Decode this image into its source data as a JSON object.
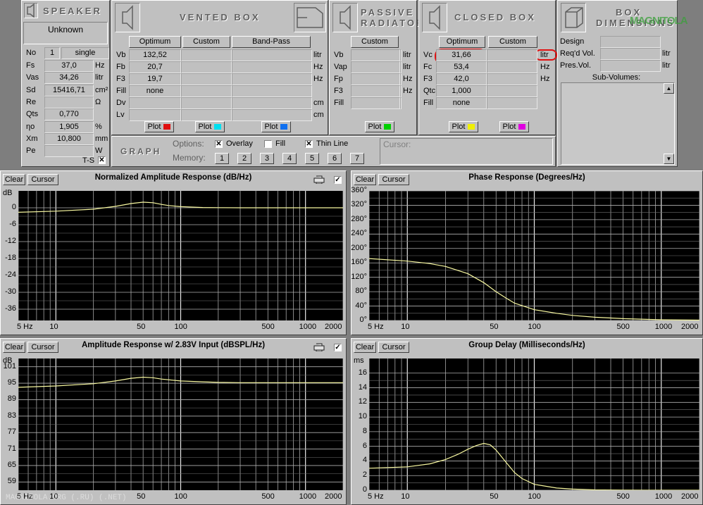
{
  "speaker": {
    "title": "SPEAKER",
    "name": "Unknown",
    "no_label": "No",
    "no_value": "1",
    "no_mode": "single",
    "params": [
      {
        "label": "Fs",
        "value": "37,0",
        "unit": "Hz"
      },
      {
        "label": "Vas",
        "value": "34,26",
        "unit": "litr"
      },
      {
        "label": "Sd",
        "value": "15416,71",
        "unit": "cm²"
      },
      {
        "label": "Re",
        "value": "",
        "unit": "Ω"
      },
      {
        "label": "Qts",
        "value": "0,770",
        "unit": ""
      },
      {
        "label": "ηo",
        "value": "1,905",
        "unit": "%"
      },
      {
        "label": "Xm",
        "value": "10,800",
        "unit": "mm"
      },
      {
        "label": "Pe",
        "value": "",
        "unit": "W"
      }
    ],
    "ts_label": "T-S"
  },
  "vented": {
    "title": "VENTED BOX",
    "tabs": [
      "Optimum",
      "Custom",
      "Band-Pass"
    ],
    "rows": [
      {
        "label": "Vb",
        "value": "132,52",
        "unit": "litr"
      },
      {
        "label": "Fb",
        "value": "20,7",
        "unit": "Hz"
      },
      {
        "label": "F3",
        "value": "19,7",
        "unit": "Hz"
      },
      {
        "label": "Fill",
        "value": "none",
        "unit": ""
      },
      {
        "label": "Dv",
        "value": "",
        "unit": "cm"
      },
      {
        "label": "Lv",
        "value": "",
        "unit": "cm"
      }
    ],
    "plot_label": "Plot"
  },
  "passive": {
    "title1": "PASSIVE",
    "title2": "RADIATOR",
    "tabs": [
      "Custom"
    ],
    "rows": [
      {
        "label": "Vb",
        "value": "",
        "unit": "litr"
      },
      {
        "label": "Vap",
        "value": "",
        "unit": "litr"
      },
      {
        "label": "Fp",
        "value": "",
        "unit": "Hz"
      },
      {
        "label": "F3",
        "value": "",
        "unit": "Hz"
      },
      {
        "label": "Fill",
        "value": "",
        "unit": ""
      }
    ],
    "plot_label": "Plot"
  },
  "closed": {
    "title": "CLOSED BOX",
    "tabs": [
      "Optimum",
      "Custom"
    ],
    "rows": [
      {
        "label": "Vc",
        "value": "31,66",
        "unit": "litr"
      },
      {
        "label": "Fc",
        "value": "53,4",
        "unit": "Hz"
      },
      {
        "label": "F3",
        "value": "42,0",
        "unit": "Hz"
      },
      {
        "label": "Qtc",
        "value": "1,000",
        "unit": ""
      },
      {
        "label": "Fill",
        "value": "none",
        "unit": ""
      }
    ],
    "plot_label": "Plot"
  },
  "dims": {
    "title1": "BOX",
    "title2": "DIMENSIONS",
    "watermark": "MAGNITOLA",
    "rows": [
      {
        "label": "Design",
        "value": "",
        "unit": ""
      },
      {
        "label": "Req'd Vol.",
        "value": "",
        "unit": "litr"
      },
      {
        "label": "Pres.Vol.",
        "value": "",
        "unit": "litr"
      }
    ],
    "subvol_label": "Sub-Volumes:"
  },
  "graph": {
    "title": "GRAPH",
    "options_label": "Options:",
    "overlay_label": "Overlay",
    "fill_label": "Fill",
    "thin_label": "Thin Line",
    "memory_label": "Memory:",
    "memory": [
      "1",
      "2",
      "3",
      "4",
      "5",
      "6",
      "7"
    ],
    "cursor_label": "Cursor:"
  },
  "buttons": {
    "clear": "Clear",
    "cursor": "Cursor"
  },
  "colors": {
    "vented_plot": "#e01010",
    "passive_plot": "#00d000",
    "closed_opt_plot": "#f0f000",
    "closed_custom_plot": "#e000e0",
    "vented_custom_plot": "#00e0f0",
    "bandpass_plot": "#1070f0",
    "curve": "#f8f8a0",
    "highlight": "#e01010"
  },
  "footer_watermark": "MAGNITOLA.ORG (.RU) (.NET)",
  "chart_data": [
    {
      "type": "line",
      "title": "Normalized Amplitude Response (dB/Hz)",
      "ylabel": "dB",
      "yticks": [
        "0",
        "-6",
        "-12",
        "-18",
        "-24",
        "-30",
        "-36"
      ],
      "ylim": [
        -40,
        6
      ],
      "xticks": [
        "5 Hz",
        "10",
        "50",
        "100",
        "500",
        "1000",
        "2000"
      ],
      "xlim": [
        5,
        2000
      ],
      "xscale": "log",
      "series": [
        {
          "x": [
            5,
            10,
            20,
            30,
            40,
            50,
            60,
            70,
            80,
            100,
            150,
            200,
            300,
            500,
            1000,
            2000
          ],
          "y": [
            -1.6,
            -1.2,
            -0.5,
            0.5,
            1.5,
            2.0,
            1.8,
            1.2,
            0.8,
            0.4,
            0.1,
            0.05,
            0.0,
            0.0,
            0.0,
            0.0
          ]
        }
      ]
    },
    {
      "type": "line",
      "title": "Phase Response (Degrees/Hz)",
      "ylabel": "",
      "yticks": [
        "360°",
        "320°",
        "280°",
        "240°",
        "200°",
        "160°",
        "120°",
        "80°",
        "40°",
        "0°"
      ],
      "ylim": [
        0,
        360
      ],
      "xticks": [
        "5 Hz",
        "10",
        "50",
        "100",
        "500",
        "1000",
        "2000"
      ],
      "xlim": [
        5,
        2000
      ],
      "xscale": "log",
      "series": [
        {
          "x": [
            5,
            10,
            15,
            20,
            30,
            40,
            50,
            60,
            70,
            100,
            150,
            200,
            300,
            500,
            1000,
            2000
          ],
          "y": [
            172,
            165,
            158,
            150,
            130,
            105,
            80,
            62,
            48,
            30,
            20,
            14,
            9,
            5,
            2,
            1
          ]
        }
      ]
    },
    {
      "type": "line",
      "title": "Amplitude Response w/ 2.83V Input (dBSPL/Hz)",
      "ylabel": "dB",
      "yticks": [
        "101",
        "95",
        "89",
        "83",
        "77",
        "71",
        "65",
        "59"
      ],
      "ylim": [
        56,
        104
      ],
      "xticks": [
        "5 Hz",
        "10",
        "50",
        "100",
        "500",
        "1000",
        "2000"
      ],
      "xlim": [
        5,
        2000
      ],
      "xscale": "log",
      "series": [
        {
          "x": [
            5,
            10,
            20,
            30,
            40,
            50,
            60,
            70,
            100,
            150,
            200,
            300,
            500,
            1000,
            2000
          ],
          "y": [
            93.5,
            94.0,
            94.8,
            95.8,
            96.8,
            97.2,
            97.0,
            96.5,
            95.8,
            95.5,
            95.3,
            95.2,
            95.2,
            95.2,
            95.2
          ]
        }
      ]
    },
    {
      "type": "line",
      "title": "Group Delay (Milliseconds/Hz)",
      "ylabel": "ms",
      "yticks": [
        "16",
        "14",
        "12",
        "10",
        "8",
        "6",
        "4",
        "2",
        "0"
      ],
      "ylim": [
        0,
        18
      ],
      "xticks": [
        "5 Hz",
        "10",
        "50",
        "100",
        "500",
        "1000",
        "2000"
      ],
      "xlim": [
        5,
        2000
      ],
      "xscale": "log",
      "series": [
        {
          "x": [
            5,
            10,
            15,
            20,
            25,
            30,
            35,
            40,
            45,
            50,
            60,
            70,
            80,
            100,
            150,
            200,
            300,
            500,
            1000,
            2000
          ],
          "y": [
            3.0,
            3.2,
            3.6,
            4.2,
            4.9,
            5.6,
            6.1,
            6.4,
            6.2,
            5.5,
            3.8,
            2.4,
            1.6,
            0.8,
            0.3,
            0.15,
            0.05,
            0.02,
            0.0,
            0.0
          ]
        }
      ]
    }
  ]
}
